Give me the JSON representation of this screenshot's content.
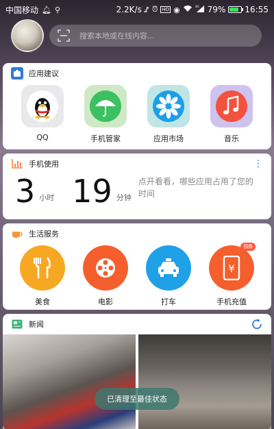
{
  "status_bar": {
    "carrier": "中国移动",
    "net_speed": "2.2K/s",
    "battery_percent": "79%",
    "battery_level": 0.79,
    "time": "16:55",
    "signal_label": "4G"
  },
  "header": {
    "search_placeholder": "搜索本地或在线内容..."
  },
  "app_suggest": {
    "title": "应用建议",
    "apps": [
      {
        "label": "QQ",
        "icon": "qq-penguin-icon"
      },
      {
        "label": "手机管家",
        "icon": "umbrella-icon"
      },
      {
        "label": "应用市场",
        "icon": "flower-icon"
      },
      {
        "label": "音乐",
        "icon": "music-note-icon"
      }
    ]
  },
  "phone_usage": {
    "title": "手机使用",
    "hours": "3",
    "hours_unit": "小时",
    "minutes": "19",
    "minutes_unit": "分钟",
    "hint": "点开看看，哪些应用占用了您的时间"
  },
  "life_services": {
    "title": "生活服务",
    "items": [
      {
        "label": "美食",
        "icon": "fork-knife-icon",
        "color": "#f7a823"
      },
      {
        "label": "电影",
        "icon": "film-reel-icon",
        "color": "#f45f2d"
      },
      {
        "label": "打车",
        "icon": "taxi-icon",
        "color": "#1ea1e6"
      },
      {
        "label": "手机充值",
        "icon": "phone-yuan-icon",
        "color": "#f45f2d",
        "badge": "领券"
      }
    ]
  },
  "news": {
    "title": "新闻"
  },
  "toast": {
    "text": "已清理至最佳状态"
  }
}
